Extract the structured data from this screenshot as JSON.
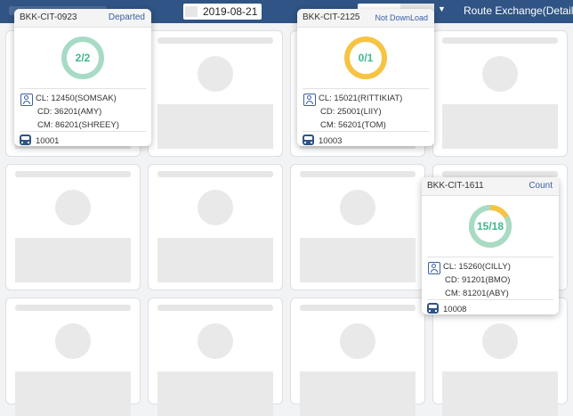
{
  "header": {
    "date": "2019-08-21",
    "route_menu": "Route Exchange(Detail)"
  },
  "colors": {
    "header_bg": "#2f5485",
    "ring_track": "#a7dbc6",
    "ring_green": "#3db88c",
    "ring_yellow": "#f6c443",
    "accent_blue": "#3a5ea8"
  },
  "cards": [
    {
      "code": "BKK-CIT-0923",
      "status": "Departed",
      "progress_label": "2/2",
      "done": 2,
      "total": 2,
      "cl": "CL: 12450(SOMSAK)",
      "cd": "CD: 36201(AMY)",
      "cm": "CM: 86201(SHREEY)",
      "vehicle": "10001"
    },
    {
      "code": "BKK-CIT-2125",
      "status": "Not DownLoad",
      "progress_label": "0/1",
      "done": 0,
      "total": 1,
      "cl": "CL: 15021(RITTIKIAT)",
      "cd": "CD: 25001(LIIY)",
      "cm": "CM: 56201(TOM)",
      "vehicle": "10003"
    },
    {
      "code": "BKK-CIT-1611",
      "status": "Count",
      "progress_label": "15/18",
      "done": 15,
      "total": 18,
      "cl": "CL: 15260(CILLY)",
      "cd": "CD: 91201(BMO)",
      "cm": "CM: 81201(ABY)",
      "vehicle": "10008"
    }
  ]
}
